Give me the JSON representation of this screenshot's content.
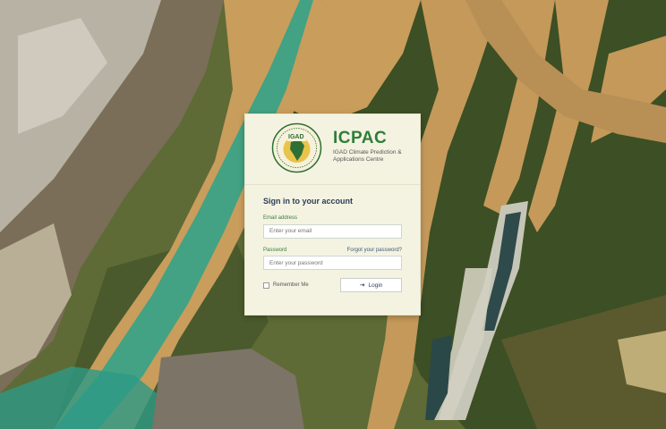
{
  "background": {
    "description_color_sand": "#c69c5a",
    "description_color_forest": "#3a4a22",
    "description_color_water": "#2aa38a"
  },
  "brand": {
    "logo_text": "IGAD",
    "name": "ICPAC",
    "subtitle": "IGAD Climate Prediction & Applications Centre",
    "color": "#2f7d3a"
  },
  "form": {
    "title": "Sign in to your account",
    "email": {
      "label": "Email address",
      "placeholder": "Enter your email",
      "value": ""
    },
    "password": {
      "label": "Password",
      "placeholder": "Enter your password",
      "value": "",
      "forgot_label": "Forgot your password?"
    },
    "remember_label": "Remember Me",
    "remember_checked": false,
    "login_label": "Login",
    "login_icon": "login-arrow-icon"
  }
}
